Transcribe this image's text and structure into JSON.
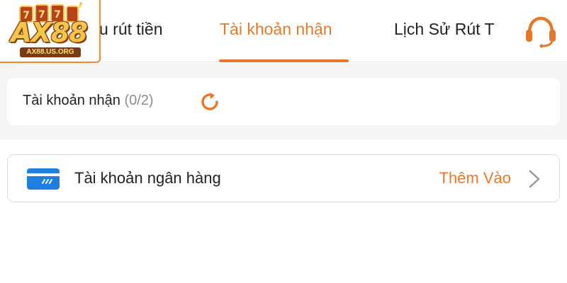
{
  "logo": {
    "text": "AX88",
    "domain": "AX88.US.ORG"
  },
  "tabs": [
    {
      "label": "u rút tiền"
    },
    {
      "label": "Tài khoản nhận",
      "active": true
    },
    {
      "label": "Lịch Sử Rút T"
    }
  ],
  "support": {
    "icon": "headset-icon"
  },
  "receive": {
    "label": "Tài khoản nhận",
    "count": "(0/2)",
    "icon": "refresh-icon"
  },
  "bank": {
    "icon": "card-icon",
    "label": "Tài khoản ngân hàng",
    "action": "Thêm Vào",
    "chevron": "chevron-right-icon"
  },
  "colors": {
    "accent": "#e7782a",
    "card_blue": "#1f7fe0",
    "band_gray": "#f5f5f5",
    "text": "#222222",
    "muted": "#8c8c8c"
  }
}
